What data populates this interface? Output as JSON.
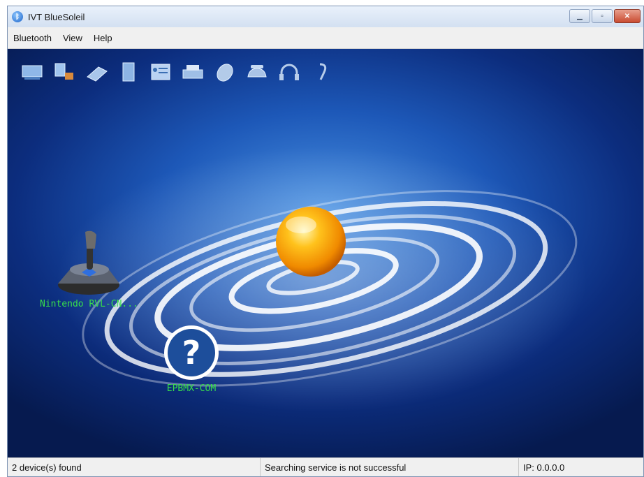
{
  "window": {
    "title": "IVT BlueSoleil",
    "controls": [
      "minimize-icon",
      "maximize-icon",
      "close-icon"
    ]
  },
  "menu": {
    "items": [
      {
        "label": "Bluetooth"
      },
      {
        "label": "View"
      },
      {
        "label": "Help"
      }
    ]
  },
  "toolbar": {
    "icons": [
      "network-access-icon",
      "dialup-network-icon",
      "fax-icon",
      "file-transfer-icon",
      "personal-info-exchange-icon",
      "printer-icon",
      "mouse-icon",
      "telephone-icon",
      "headset-icon",
      "earpiece-icon"
    ]
  },
  "devices": [
    {
      "name": "Nintendo RVL-CN...",
      "icon": "joystick-icon"
    },
    {
      "name": "EPBMX-COM",
      "icon": "question-mark-icon"
    }
  ],
  "status": {
    "devices_found": "2 device(s) found",
    "message": "Searching service is not successful",
    "ip": "IP: 0.0.0.0"
  }
}
